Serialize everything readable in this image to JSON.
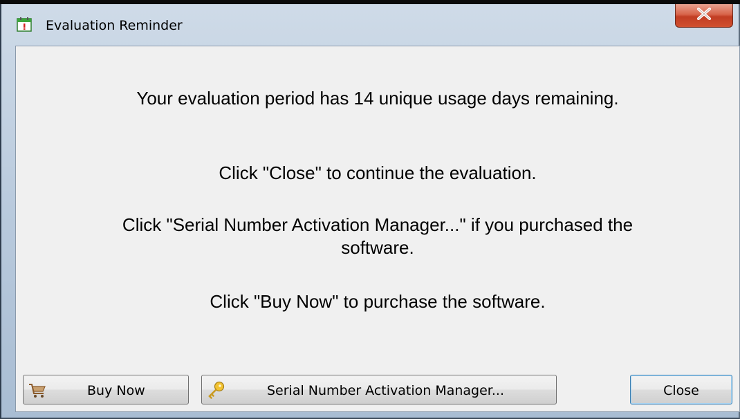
{
  "window": {
    "title": "Evaluation Reminder",
    "icon": "calendar-icon",
    "close_icon": "close-icon"
  },
  "messages": {
    "remaining": "Your evaluation period has 14 unique usage days remaining.",
    "close_hint": "Click \"Close\" to continue the evaluation.",
    "serial_hint_line1": "Click \"Serial Number Activation Manager...\" if you purchased the",
    "serial_hint_line2": "software.",
    "buy_hint": "Click \"Buy Now\" to purchase the software."
  },
  "buttons": {
    "buy_now": {
      "label": "Buy Now",
      "icon": "cart-icon"
    },
    "serial": {
      "label": "Serial Number Activation Manager...",
      "icon": "key-icon"
    },
    "close": {
      "label": "Close"
    }
  },
  "colors": {
    "close_button_red": "#c13d23",
    "focus_blue": "#3c7fb1",
    "dialog_bg": "#f0f0f0"
  }
}
